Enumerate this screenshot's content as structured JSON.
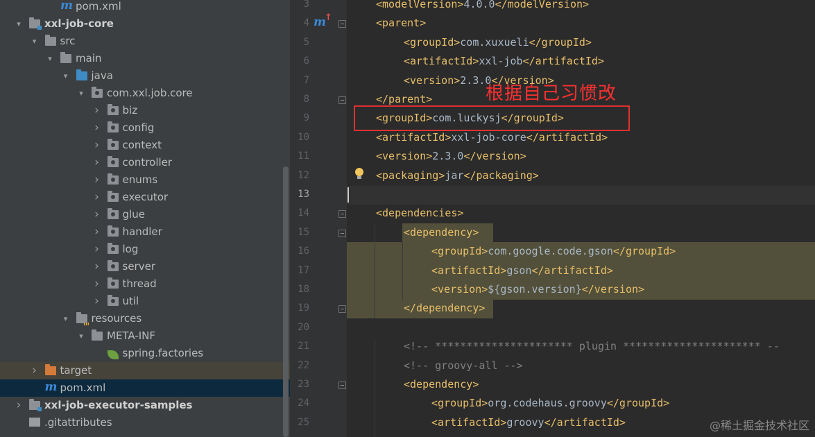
{
  "project_tree": {
    "items": [
      {
        "label": "pom.xml",
        "icon": "maven-icon",
        "depth": 3,
        "arrow": ""
      },
      {
        "label": "xxl-job-core",
        "icon": "module-folder-icon",
        "depth": 1,
        "arrow": "down",
        "bold": true
      },
      {
        "label": "src",
        "icon": "folder-icon",
        "depth": 2,
        "arrow": "down"
      },
      {
        "label": "main",
        "icon": "folder-icon",
        "depth": 3,
        "arrow": "down"
      },
      {
        "label": "java",
        "icon": "source-folder-icon",
        "depth": 4,
        "arrow": "down"
      },
      {
        "label": "com.xxl.job.core",
        "icon": "package-icon",
        "depth": 5,
        "arrow": "down"
      },
      {
        "label": "biz",
        "icon": "package-icon",
        "depth": 6,
        "arrow": "right"
      },
      {
        "label": "config",
        "icon": "package-icon",
        "depth": 6,
        "arrow": "right"
      },
      {
        "label": "context",
        "icon": "package-icon",
        "depth": 6,
        "arrow": "right"
      },
      {
        "label": "controller",
        "icon": "package-icon",
        "depth": 6,
        "arrow": "right"
      },
      {
        "label": "enums",
        "icon": "package-icon",
        "depth": 6,
        "arrow": "right"
      },
      {
        "label": "executor",
        "icon": "package-icon",
        "depth": 6,
        "arrow": "right"
      },
      {
        "label": "glue",
        "icon": "package-icon",
        "depth": 6,
        "arrow": "right"
      },
      {
        "label": "handler",
        "icon": "package-icon",
        "depth": 6,
        "arrow": "right"
      },
      {
        "label": "log",
        "icon": "package-icon",
        "depth": 6,
        "arrow": "right"
      },
      {
        "label": "server",
        "icon": "package-icon",
        "depth": 6,
        "arrow": "right"
      },
      {
        "label": "thread",
        "icon": "package-icon",
        "depth": 6,
        "arrow": "right"
      },
      {
        "label": "util",
        "icon": "package-icon",
        "depth": 6,
        "arrow": "right"
      },
      {
        "label": "resources",
        "icon": "resources-folder-icon",
        "depth": 4,
        "arrow": "down"
      },
      {
        "label": "META-INF",
        "icon": "folder-icon",
        "depth": 5,
        "arrow": "down"
      },
      {
        "label": "spring.factories",
        "icon": "spring-leaf-icon",
        "depth": 6,
        "arrow": ""
      },
      {
        "label": "target",
        "icon": "excluded-folder-icon",
        "depth": 2,
        "arrow": "right",
        "state": "excluded"
      },
      {
        "label": "pom.xml",
        "icon": "maven-icon",
        "depth": 2,
        "arrow": "",
        "state": "selected"
      },
      {
        "label": "xxl-job-executor-samples",
        "icon": "module-folder-icon",
        "depth": 1,
        "arrow": "right",
        "bold": true
      },
      {
        "label": ".gitattributes",
        "icon": "file-icon",
        "depth": 1,
        "arrow": ""
      }
    ]
  },
  "editor": {
    "lines": [
      {
        "num": "3",
        "indent": 1,
        "html": [
          [
            "tag",
            "<modelVersion>"
          ],
          [
            "txt",
            "4.0.0"
          ],
          [
            "tag",
            "</modelVersion>"
          ]
        ]
      },
      {
        "num": "4",
        "indent": 1,
        "html": [
          [
            "tag",
            "<parent>"
          ]
        ]
      },
      {
        "num": "5",
        "indent": 2,
        "html": [
          [
            "tag",
            "<groupId>"
          ],
          [
            "txt",
            "com.xuxueli"
          ],
          [
            "tag",
            "</groupId>"
          ]
        ]
      },
      {
        "num": "6",
        "indent": 2,
        "html": [
          [
            "tag",
            "<artifactId>"
          ],
          [
            "txt",
            "xxl-job"
          ],
          [
            "tag",
            "</artifactId>"
          ]
        ]
      },
      {
        "num": "7",
        "indent": 2,
        "html": [
          [
            "tag",
            "<version>"
          ],
          [
            "txt",
            "2.3.0"
          ],
          [
            "tag",
            "</version>"
          ]
        ]
      },
      {
        "num": "8",
        "indent": 1,
        "html": [
          [
            "tag",
            "</parent>"
          ]
        ]
      },
      {
        "num": "9",
        "indent": 1,
        "html": [
          [
            "tag",
            "<groupId>"
          ],
          [
            "txt",
            "com.luckysj"
          ],
          [
            "tag",
            "</groupId>"
          ]
        ]
      },
      {
        "num": "10",
        "indent": 1,
        "html": [
          [
            "tag",
            "<artifactId>"
          ],
          [
            "txt",
            "xxl-job-core"
          ],
          [
            "tag",
            "</artifactId>"
          ]
        ]
      },
      {
        "num": "11",
        "indent": 1,
        "html": [
          [
            "tag",
            "<version>"
          ],
          [
            "txt",
            "2.3.0"
          ],
          [
            "tag",
            "</version>"
          ]
        ]
      },
      {
        "num": "12",
        "indent": 1,
        "html": [
          [
            "tag",
            "<packaging>"
          ],
          [
            "txt",
            "jar"
          ],
          [
            "tag",
            "</packaging>"
          ]
        ]
      },
      {
        "num": "13",
        "indent": 0,
        "html": []
      },
      {
        "num": "14",
        "indent": 1,
        "html": [
          [
            "tag",
            "<dependencies>"
          ]
        ]
      },
      {
        "num": "15",
        "indent": 2,
        "html": [
          [
            "tag",
            "<dependency>"
          ]
        ]
      },
      {
        "num": "16",
        "indent": 3,
        "html": [
          [
            "tag",
            "<groupId>"
          ],
          [
            "txt",
            "com.google.code.gson"
          ],
          [
            "tag",
            "</groupId>"
          ]
        ]
      },
      {
        "num": "17",
        "indent": 3,
        "html": [
          [
            "tag",
            "<artifactId>"
          ],
          [
            "txt",
            "gson"
          ],
          [
            "tag",
            "</artifactId>"
          ]
        ]
      },
      {
        "num": "18",
        "indent": 3,
        "html": [
          [
            "tag",
            "<version>"
          ],
          [
            "txt",
            "${gson.version}"
          ],
          [
            "tag",
            "</version>"
          ]
        ]
      },
      {
        "num": "19",
        "indent": 2,
        "html": [
          [
            "tag",
            "</dependency>"
          ]
        ]
      },
      {
        "num": "20",
        "indent": 0,
        "html": []
      },
      {
        "num": "21",
        "indent": 2,
        "html": [
          [
            "cmt",
            "<!-- ********************** plugin ********************** --"
          ]
        ]
      },
      {
        "num": "22",
        "indent": 2,
        "html": [
          [
            "cmt",
            "<!-- groovy-all -->"
          ]
        ]
      },
      {
        "num": "23",
        "indent": 2,
        "html": [
          [
            "tag",
            "<dependency>"
          ]
        ]
      },
      {
        "num": "24",
        "indent": 3,
        "html": [
          [
            "tag",
            "<groupId>"
          ],
          [
            "txt",
            "org.codehaus.groovy"
          ],
          [
            "tag",
            "</groupId>"
          ]
        ]
      },
      {
        "num": "25",
        "indent": 3,
        "html": [
          [
            "tag",
            "<artifactId>"
          ],
          [
            "txt",
            "groovy"
          ],
          [
            "tag",
            "</artifactId>"
          ]
        ]
      }
    ],
    "current_line": "13",
    "fold_lines": [
      "4",
      "8",
      "14",
      "15",
      "19",
      "23"
    ]
  },
  "annotation": {
    "text": "根据自己习惯改",
    "color": "#ff3030"
  },
  "watermark": "@稀土掘金技术社区",
  "gutter_maven_marker": "m",
  "colors": {
    "tree_bg": "#3c3f41",
    "editor_bg": "#2b2b2b",
    "tag": "#e8bf6a",
    "text": "#a9b7c6",
    "selection": "#0d293e"
  }
}
